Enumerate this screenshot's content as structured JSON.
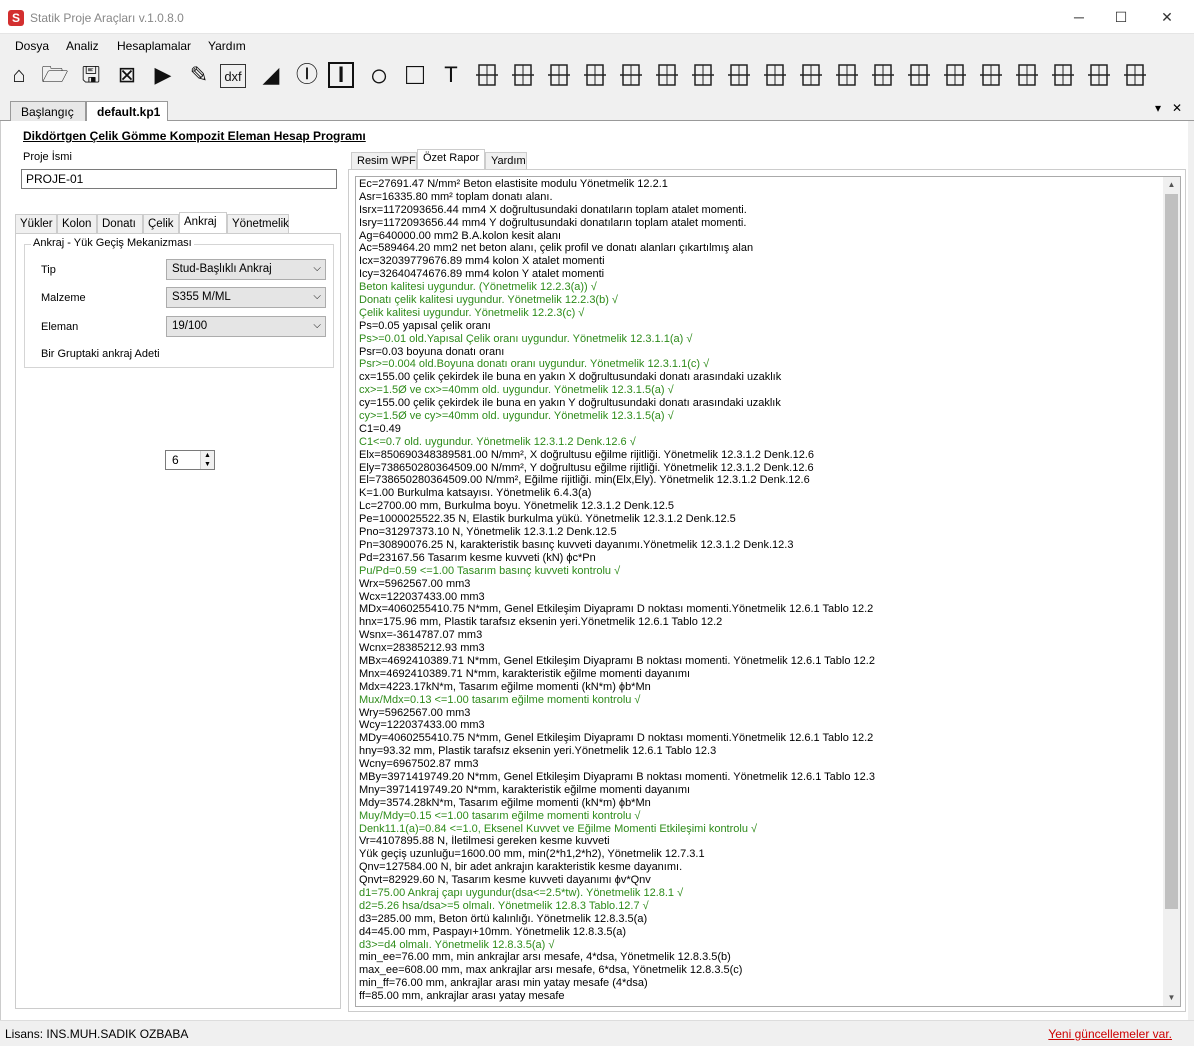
{
  "window": {
    "title": "Statik Proje Araçları v.1.0.8.0",
    "logo": "S",
    "minimize": "─",
    "maximize": "☐",
    "close": "✕"
  },
  "menu": [
    "Dosya",
    "Analiz",
    "Hesaplamalar",
    "Yardım"
  ],
  "toolbar_icons": [
    "home-icon",
    "open-folder-icon",
    "save-icon",
    "export-icon",
    "play-icon",
    "edit-icon",
    "dxf-icon",
    "shape-icon",
    "i-section-round-icon",
    "i-section-box-icon",
    "circle-section-icon",
    "rectangle-section-icon",
    "t-beam-icon",
    "column-icon",
    "column-k-icon",
    "beam-connection-icon",
    "beam-plate-icon",
    "moment-connection-icon",
    "column-base-icon",
    "splice-icon",
    "double-angle-icon",
    "bolt-row-icon",
    "flange-icon",
    "web-icon",
    "end-plate-icon",
    "stiffener-icon",
    "gusset-icon",
    "bracket-icon",
    "bolt-group-icon",
    "u-section-icon",
    "t-section-icon",
    "h-section-icon"
  ],
  "doc_tabs": {
    "home": "Başlangıç",
    "file": "default.kp1",
    "dropdown": "▾",
    "close": "✕"
  },
  "program_title": "Dikdörtgen Çelik Gömme Kompozit Eleman Hesap Programı",
  "project": {
    "label": "Proje İsmi",
    "value": "PROJE-01"
  },
  "left_tabs": [
    "Yükler",
    "Kolon",
    "Donatı",
    "Çelik",
    "Ankraj",
    "Yönetmelik"
  ],
  "anchor": {
    "group_title": "Ankraj - Yük Geçiş Mekanizması",
    "type_label": "Tip",
    "type_value": "Stud-Başlıklı Ankraj",
    "material_label": "Malzeme",
    "material_value": "S355 M/ML",
    "element_label": "Eleman",
    "element_value": "19/100",
    "count_label": "Bir Gruptaki ankraj Adeti",
    "count_value": "6"
  },
  "right_tabs": [
    "Resim WPF",
    "Özet Rapor",
    "Yardım"
  ],
  "report": [
    {
      "t": "Ec=27691.47 N/mm² Beton elastisite modulu Yönetmelik 12.2.1",
      "ok": false
    },
    {
      "t": "Asr=16335.80 mm² toplam donatı alanı.",
      "ok": false
    },
    {
      "t": "Isrx=1172093656.44 mm4 X doğrultusundaki donatıların toplam atalet momenti.",
      "ok": false
    },
    {
      "t": "Isry=1172093656.44 mm4 Y doğrultusundaki donatıların toplam atalet momenti.",
      "ok": false
    },
    {
      "t": "Ag=640000.00 mm2 B.A.kolon kesit alanı",
      "ok": false
    },
    {
      "t": "Ac=589464.20 mm2 net beton alanı, çelik profil ve donatı alanları çıkartılmış alan",
      "ok": false
    },
    {
      "t": "Icx=32039779676.89 mm4 kolon X atalet momenti",
      "ok": false
    },
    {
      "t": "Icy=32640474676.89 mm4 kolon Y atalet momenti",
      "ok": false
    },
    {
      "t": "Beton kalitesi uygundur. (Yönetmelik 12.2.3(a)) √",
      "ok": true
    },
    {
      "t": "Donatı çelik kalitesi uygundur. Yönetmelik 12.2.3(b) √",
      "ok": true
    },
    {
      "t": "Çelik kalitesi uygundur. Yönetmelik 12.2.3(c) √",
      "ok": true
    },
    {
      "t": "Ps=0.05 yapısal çelik oranı",
      "ok": false
    },
    {
      "t": "Ps>=0.01 old.Yapısal Çelik oranı uygundur. Yönetmelik 12.3.1.1(a) √",
      "ok": true
    },
    {
      "t": "Psr=0.03 boyuna donatı oranı",
      "ok": false
    },
    {
      "t": "Psr>=0.004 old.Boyuna donatı oranı uygundur. Yönetmelik 12.3.1.1(c) √",
      "ok": true
    },
    {
      "t": "cx=155.00 çelik çekirdek ile buna en yakın X doğrultusundaki donatı arasındaki uzaklık",
      "ok": false
    },
    {
      "t": "cx>=1.5Ø ve cx>=40mm old. uygundur. Yönetmelik 12.3.1.5(a) √",
      "ok": true
    },
    {
      "t": "cy=155.00 çelik çekirdek ile buna en yakın Y doğrultusundaki donatı arasındaki uzaklık",
      "ok": false
    },
    {
      "t": "cy>=1.5Ø ve cy>=40mm old. uygundur. Yönetmelik 12.3.1.5(a) √",
      "ok": true
    },
    {
      "t": "C1=0.49",
      "ok": false
    },
    {
      "t": "C1<=0.7 old. uygundur. Yönetmelik 12.3.1.2 Denk.12.6 √",
      "ok": true
    },
    {
      "t": "Elx=850690348389581.00 N/mm², X doğrultusu eğilme rijitliği. Yönetmelik 12.3.1.2 Denk.12.6",
      "ok": false
    },
    {
      "t": "Ely=738650280364509.00 N/mm², Y doğrultusu eğilme rijitliği. Yönetmelik 12.3.1.2 Denk.12.6",
      "ok": false
    },
    {
      "t": "El=738650280364509.00 N/mm², Eğilme rijitliği. min(Elx,Ely). Yönetmelik 12.3.1.2 Denk.12.6",
      "ok": false
    },
    {
      "t": "K=1.00 Burkulma katsayısı. Yönetmelik 6.4.3(a)",
      "ok": false
    },
    {
      "t": "Lc=2700.00 mm, Burkulma boyu. Yönetmelik 12.3.1.2 Denk.12.5",
      "ok": false
    },
    {
      "t": "Pe=1000025522.35 N, Elastik burkulma yükü. Yönetmelik 12.3.1.2 Denk.12.5",
      "ok": false
    },
    {
      "t": "Pno=31297373.10 N, Yönetmelik 12.3.1.2 Denk.12.5",
      "ok": false
    },
    {
      "t": "Pn=30890076.25 N, karakteristik basınç kuvveti dayanımı.Yönetmelik 12.3.1.2 Denk.12.3",
      "ok": false
    },
    {
      "t": "Pd=23167.56 Tasarım kesme kuvveti (kN) ϕc*Pn",
      "ok": false
    },
    {
      "t": "Pu/Pd=0.59 <=1.00 Tasarım basınç kuvveti kontrolu √",
      "ok": true
    },
    {
      "t": "Wrx=5962567.00 mm3",
      "ok": false
    },
    {
      "t": "Wcx=122037433.00 mm3",
      "ok": false
    },
    {
      "t": "MDx=4060255410.75 N*mm, Genel Etkileşim Diyapramı D noktası momenti.Yönetmelik 12.6.1 Tablo 12.2",
      "ok": false
    },
    {
      "t": "hnx=175.96 mm, Plastik tarafsız eksenin yeri.Yönetmelik 12.6.1 Tablo 12.2",
      "ok": false
    },
    {
      "t": "Wsnx=-3614787.07 mm3",
      "ok": false
    },
    {
      "t": "Wcnx=28385212.93 mm3",
      "ok": false
    },
    {
      "t": "MBx=4692410389.71 N*mm, Genel Etkileşim Diyapramı B noktası momenti. Yönetmelik 12.6.1 Tablo 12.2",
      "ok": false
    },
    {
      "t": "Mnx=4692410389.71 N*mm, karakteristik eğilme momenti dayanımı",
      "ok": false
    },
    {
      "t": "Mdx=4223.17kN*m, Tasarım eğilme momenti (kN*m) ϕb*Mn",
      "ok": false
    },
    {
      "t": "Mux/Mdx=0.13 <=1.00 tasarım eğilme momenti kontrolu √",
      "ok": true
    },
    {
      "t": "Wry=5962567.00 mm3",
      "ok": false
    },
    {
      "t": "Wcy=122037433.00 mm3",
      "ok": false
    },
    {
      "t": "MDy=4060255410.75 N*mm, Genel Etkileşim Diyapramı D noktası momenti.Yönetmelik 12.6.1 Tablo 12.2",
      "ok": false
    },
    {
      "t": "hny=93.32 mm, Plastik tarafsız eksenin yeri.Yönetmelik 12.6.1 Tablo 12.3",
      "ok": false
    },
    {
      "t": "Wcny=6967502.87 mm3",
      "ok": false
    },
    {
      "t": "MBy=3971419749.20 N*mm, Genel Etkileşim Diyapramı B noktası momenti. Yönetmelik 12.6.1 Tablo 12.3",
      "ok": false
    },
    {
      "t": "Mny=3971419749.20 N*mm, karakteristik eğilme momenti dayanımı",
      "ok": false
    },
    {
      "t": "Mdy=3574.28kN*m, Tasarım eğilme momenti (kN*m) ϕb*Mn",
      "ok": false
    },
    {
      "t": "Muy/Mdy=0.15 <=1.00 tasarım eğilme momenti kontrolu √",
      "ok": true
    },
    {
      "t": "Denk11.1(a)=0.84 <=1.0, Eksenel Kuvvet ve Eğilme Momenti Etkileşimi kontrolu √",
      "ok": true
    },
    {
      "t": "Vr=4107895.88 N, İletilmesi gereken kesme kuvveti",
      "ok": false
    },
    {
      "t": "Yük geçiş uzunluğu=1600.00 mm, min(2*h1,2*h2), Yönetmelik 12.7.3.1",
      "ok": false
    },
    {
      "t": "Qnv=127584.00 N, bir adet ankrajın karakteristik kesme dayanımı.",
      "ok": false
    },
    {
      "t": "Qnvt=82929.60 N, Tasarım kesme kuvveti dayanımı ϕv*Qnv",
      "ok": false
    },
    {
      "t": "d1=75.00 Ankraj çapı uygundur(dsa<=2.5*tw). Yönetmelik 12.8.1 √",
      "ok": true
    },
    {
      "t": "d2=5.26 hsa/dsa>=5 olmalı. Yönetmelik 12.8.3 Tablo.12.7 √",
      "ok": true
    },
    {
      "t": "d3=285.00 mm, Beton örtü kalınlığı. Yönetmelik 12.8.3.5(a)",
      "ok": false
    },
    {
      "t": "d4=45.00 mm, Paspayı+10mm. Yönetmelik 12.8.3.5(a)",
      "ok": false
    },
    {
      "t": "d3>=d4 olmalı. Yönetmelik 12.8.3.5(a) √",
      "ok": true
    },
    {
      "t": "min_ee=76.00 mm, min ankrajlar arsı mesafe, 4*dsa, Yönetmelik 12.8.3.5(b)",
      "ok": false
    },
    {
      "t": "max_ee=608.00 mm, max ankrajlar arsı mesafe, 6*dsa, Yönetmelik 12.8.3.5(c)",
      "ok": false
    },
    {
      "t": "min_ff=76.00 mm, ankrajlar arası min yatay mesafe (4*dsa)",
      "ok": false
    },
    {
      "t": "ff=85.00 mm, ankrajlar arası yatay mesafe",
      "ok": false
    }
  ],
  "colors": {
    "ok": "#2e8b1a",
    "update": "#cc0000"
  },
  "status": {
    "license": "Lisans: INS.MUH.SADIK OZBABA",
    "update": "Yeni güncellemeler var."
  }
}
